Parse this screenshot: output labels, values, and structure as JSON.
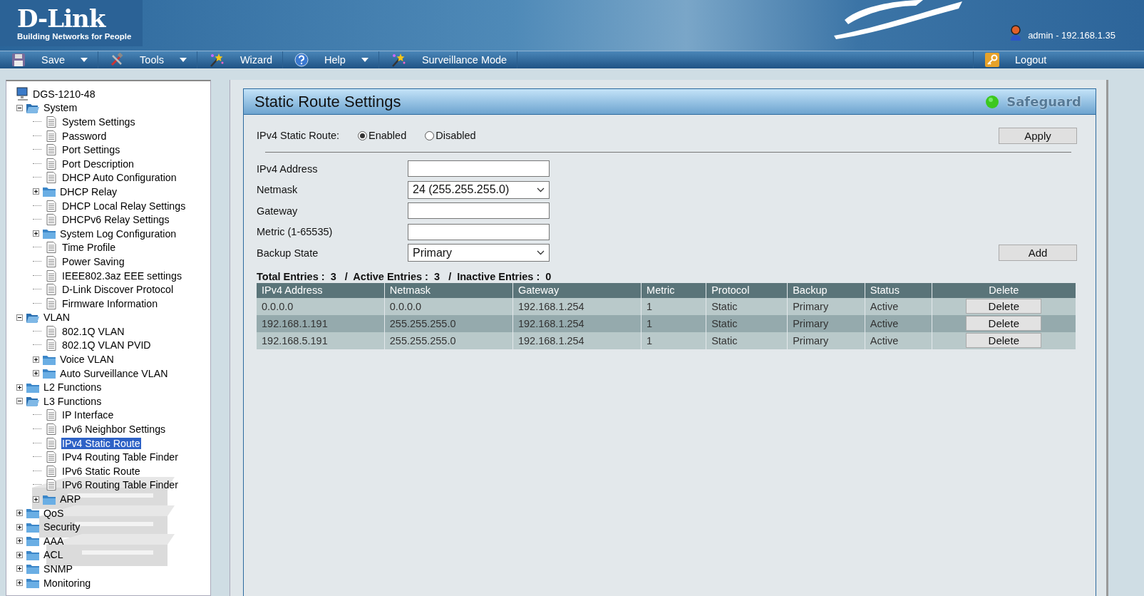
{
  "header": {
    "brand": "D-Link",
    "tagline": "Building Networks for People",
    "user": "admin - 192.168.1.35"
  },
  "menu": [
    {
      "label": "Save",
      "dropdown": true
    },
    {
      "label": "Tools",
      "dropdown": true
    },
    {
      "label": "Wizard",
      "dropdown": false
    },
    {
      "label": "Help",
      "dropdown": true
    },
    {
      "label": "Surveillance Mode",
      "dropdown": false
    }
  ],
  "logout": "Logout",
  "tree": {
    "label": "DGS-1210-48",
    "children": [
      {
        "label": "System",
        "kind": "folder",
        "expanded": true,
        "children": [
          {
            "label": "System Settings",
            "kind": "page",
            "selected": false
          },
          {
            "label": "Password",
            "kind": "page",
            "selected": false
          },
          {
            "label": "Port Settings",
            "kind": "page",
            "selected": false
          },
          {
            "label": "Port Description",
            "kind": "page",
            "selected": false
          },
          {
            "label": "DHCP Auto Configuration",
            "kind": "page",
            "selected": false
          },
          {
            "label": "DHCP Relay",
            "kind": "folder",
            "expanded": false
          },
          {
            "label": "DHCP Local Relay Settings",
            "kind": "page",
            "selected": false
          },
          {
            "label": "DHCPv6 Relay Settings",
            "kind": "page",
            "selected": false
          },
          {
            "label": "System Log Configuration",
            "kind": "folder",
            "expanded": false
          },
          {
            "label": "Time Profile",
            "kind": "page",
            "selected": false
          },
          {
            "label": "Power Saving",
            "kind": "page",
            "selected": false
          },
          {
            "label": "IEEE802.3az EEE settings",
            "kind": "page",
            "selected": false
          },
          {
            "label": "D-Link Discover Protocol",
            "kind": "page",
            "selected": false
          },
          {
            "label": "Firmware Information",
            "kind": "page",
            "selected": false
          }
        ]
      },
      {
        "label": "VLAN",
        "kind": "folder",
        "expanded": true,
        "children": [
          {
            "label": "802.1Q VLAN",
            "kind": "page",
            "selected": false
          },
          {
            "label": "802.1Q VLAN PVID",
            "kind": "page",
            "selected": false
          },
          {
            "label": "Voice VLAN",
            "kind": "folder",
            "expanded": false
          },
          {
            "label": "Auto Surveillance VLAN",
            "kind": "folder",
            "expanded": false
          }
        ]
      },
      {
        "label": "L2 Functions",
        "kind": "folder",
        "expanded": false
      },
      {
        "label": "L3 Functions",
        "kind": "folder",
        "expanded": true,
        "children": [
          {
            "label": "IP Interface",
            "kind": "page",
            "selected": false
          },
          {
            "label": "IPv6 Neighbor Settings",
            "kind": "page",
            "selected": false
          },
          {
            "label": "IPv4 Static Route",
            "kind": "page",
            "selected": true
          },
          {
            "label": "IPv4 Routing Table Finder",
            "kind": "page",
            "selected": false
          },
          {
            "label": "IPv6 Static Route",
            "kind": "page",
            "selected": false
          },
          {
            "label": "IPv6 Routing Table Finder",
            "kind": "page",
            "selected": false
          },
          {
            "label": "ARP",
            "kind": "folder",
            "expanded": false
          }
        ]
      },
      {
        "label": "QoS",
        "kind": "folder",
        "expanded": false
      },
      {
        "label": "Security",
        "kind": "folder",
        "expanded": false
      },
      {
        "label": "AAA",
        "kind": "folder",
        "expanded": false
      },
      {
        "label": "ACL",
        "kind": "folder",
        "expanded": false
      },
      {
        "label": "SNMP",
        "kind": "folder",
        "expanded": false
      },
      {
        "label": "Monitoring",
        "kind": "folder",
        "expanded": false
      }
    ]
  },
  "panel": {
    "title": "Static Route Settings",
    "safeguard": "Safeguard",
    "route_label": "IPv4 Static Route:",
    "radios": [
      {
        "label": "Enabled",
        "selected": true
      },
      {
        "label": "Disabled",
        "selected": false
      }
    ],
    "apply": "Apply",
    "add": "Add",
    "fields": [
      {
        "label": "IPv4 Address",
        "kind": "text"
      },
      {
        "label": "Netmask",
        "kind": "select",
        "value": "24 (255.255.255.0)"
      },
      {
        "label": "Gateway",
        "kind": "text"
      },
      {
        "label": "Metric (1-65535)",
        "kind": "text"
      },
      {
        "label": "Backup State",
        "kind": "select",
        "value": "Primary"
      }
    ],
    "summary": "Total Entries :  3   /  Active Entries :  3   /  Inactive Entries :  0"
  },
  "table": {
    "columns": [
      "IPv4 Address",
      "Netmask",
      "Gateway",
      "Metric",
      "Protocol",
      "Backup",
      "Status",
      "Delete"
    ],
    "rows": [
      {
        "cells": [
          "0.0.0.0",
          "0.0.0.0",
          "192.168.1.254",
          "1",
          "Static",
          "Primary",
          "Active"
        ],
        "action": "Delete"
      },
      {
        "cells": [
          "192.168.1.191",
          "255.255.255.0",
          "192.168.1.254",
          "1",
          "Static",
          "Primary",
          "Active"
        ],
        "action": "Delete"
      },
      {
        "cells": [
          "192.168.5.191",
          "255.255.255.0",
          "192.168.1.254",
          "1",
          "Static",
          "Primary",
          "Active"
        ],
        "action": "Delete"
      }
    ]
  }
}
